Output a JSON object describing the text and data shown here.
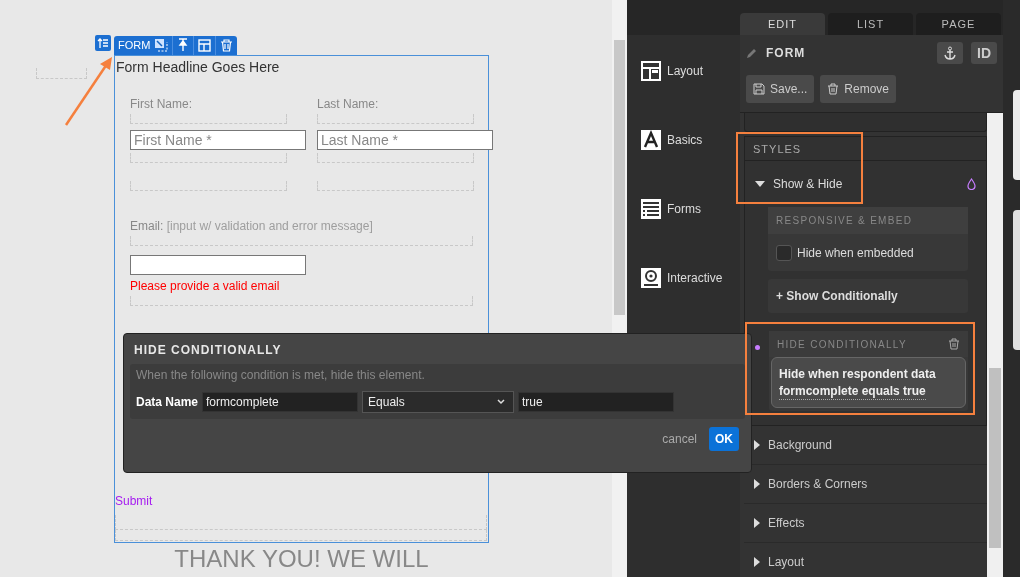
{
  "canvas": {
    "toolbar": {
      "label": "FORM"
    },
    "form": {
      "headline": "Form Headline Goes Here",
      "name_fields": [
        {
          "label": "First Name:",
          "placeholder": "First Name *"
        },
        {
          "label": "Last Name:",
          "placeholder": "Last Name *"
        }
      ],
      "email": {
        "label": "Email:",
        "hint": "[input w/ validation and error message]",
        "error": "Please provide a valid email"
      },
      "submit": "Submit"
    },
    "footer_text": "THANK YOU! WE WILL"
  },
  "dialog": {
    "title": "HIDE CONDITIONALLY",
    "description": "When the following condition is met, hide this element.",
    "field_label": "Data Name",
    "data_name": "formcomplete",
    "operator": "Equals",
    "value": "true",
    "cancel": "cancel",
    "ok": "OK"
  },
  "categories": [
    {
      "label": "Layout",
      "kind": "layout"
    },
    {
      "label": "Basics",
      "kind": "text"
    },
    {
      "label": "Forms",
      "kind": "form"
    },
    {
      "label": "Interactive",
      "kind": "interactive"
    }
  ],
  "tabs": [
    {
      "label": "EDIT",
      "selected": true
    },
    {
      "label": "LIST",
      "selected": false
    },
    {
      "label": "PAGE",
      "selected": false
    }
  ],
  "element": {
    "title": "FORM",
    "id_button": "ID",
    "save": "Save...",
    "remove": "Remove"
  },
  "styles": {
    "heading": "STYLES",
    "show_hide": {
      "label": "Show & Hide",
      "expanded": true
    },
    "responsive_heading": "RESPONSIVE & EMBED",
    "hide_embedded": {
      "label": "Hide when embedded",
      "checked": false
    },
    "show_conditionally": "+ Show Conditionally",
    "hide_conditionally": {
      "heading": "HIDE CONDITIONALLY",
      "rule": "Hide when respondent data",
      "condition": "formcomplete equals true"
    }
  },
  "sections": [
    {
      "label": "Background",
      "expanded": false
    },
    {
      "label": "Borders & Corners",
      "expanded": false
    },
    {
      "label": "Effects",
      "expanded": false
    },
    {
      "label": "Layout",
      "expanded": false
    }
  ]
}
